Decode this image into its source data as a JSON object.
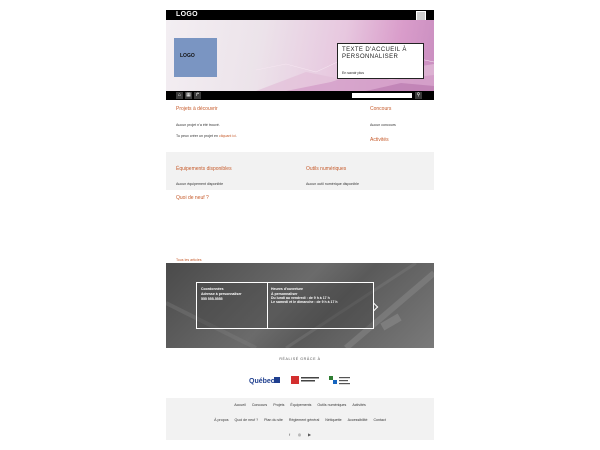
{
  "topbar": {
    "logo": "LOGO"
  },
  "banner": {
    "logo": "LOGO",
    "welcome_title": "TEXTE D'ACCUEIL À PERSONNALISER",
    "more_link": "En savoir plus"
  },
  "nav": {
    "home_icon": "home-icon",
    "grid_icon": "grid-icon",
    "share_icon": "share-icon",
    "search_placeholder": ""
  },
  "projects": {
    "title": "Projets à découvrir",
    "empty": "Aucun projet n'a été trouvé.",
    "create_prefix": "Tu peux créer un projet en ",
    "create_link": "cliquant ici",
    "create_suffix": "."
  },
  "contests": {
    "title": "Concours",
    "empty": "Aucun concours"
  },
  "activities": {
    "title": "Activités",
    "empty": "Aucune activité n'est prévue"
  },
  "equipment": {
    "title": "Équipements disponibles",
    "empty": "Aucun équipement disponible"
  },
  "digital_tools": {
    "title": "Outils numériques",
    "empty": "Aucun outil numérique disponible"
  },
  "news": {
    "title": "Quoi de neuf ?",
    "all_link": "Tous les articles"
  },
  "footer_contact": {
    "heading": "Coordonnées",
    "address": "Adresse à personnaliser",
    "phone": "555 555-5555",
    "hours_heading": "Heures d'ouverture",
    "hours_custom": "À personnaliser",
    "hours_week": "Du lundi au vendredi : de 9 h à 17 h",
    "hours_weekend": "Le samedi et le dimanche : de 9 h à 17 h"
  },
  "credits": {
    "label": "RÉALISÉ GRÂCE À",
    "sponsors": [
      "Québec",
      "Bibliothèque et Archives nationales",
      "Bibliothèque et Archives nationales du Québec"
    ]
  },
  "footer_links_1": [
    "Accueil",
    "Concours",
    "Projets",
    "Équipements",
    "Outils numériques",
    "Activités"
  ],
  "footer_links_2": [
    "À propos",
    "Quoi de neuf ?",
    "Plan du site",
    "Règlement général",
    "Nétiquette",
    "Accessibilité",
    "Contact"
  ],
  "social": [
    "facebook-icon",
    "instagram-icon",
    "youtube-icon"
  ],
  "colors": {
    "accent": "#c65a2a",
    "banner_pink": "#d99cca",
    "logo_blue": "#7a95c2"
  }
}
